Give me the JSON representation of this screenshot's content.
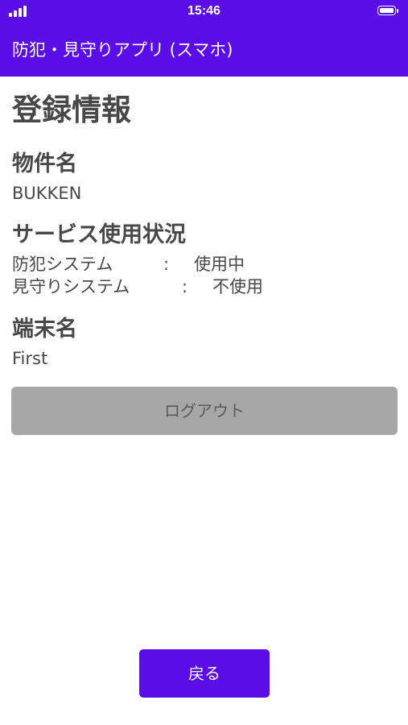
{
  "status_bar": {
    "time": "15:46",
    "signal_icon": "signal-bars-icon",
    "battery_icon": "battery-icon"
  },
  "header": {
    "title": "防犯・見守りアプリ (スマホ)"
  },
  "page": {
    "title": "登録情報"
  },
  "property": {
    "heading": "物件名",
    "value": "BUKKEN"
  },
  "service_usage": {
    "heading": "サービス使用状況",
    "rows": [
      {
        "name": "防犯システム",
        "separator": ":",
        "status": "使用中"
      },
      {
        "name": "見守りシステム",
        "separator": ":",
        "status": "不使用"
      }
    ]
  },
  "device": {
    "heading": "端末名",
    "value": "First"
  },
  "buttons": {
    "logout_label": "ログアウト",
    "back_label": "戻る"
  },
  "colors": {
    "accent": "#5a0de6",
    "disabled_button": "#a7a7a7",
    "text": "#484848"
  }
}
